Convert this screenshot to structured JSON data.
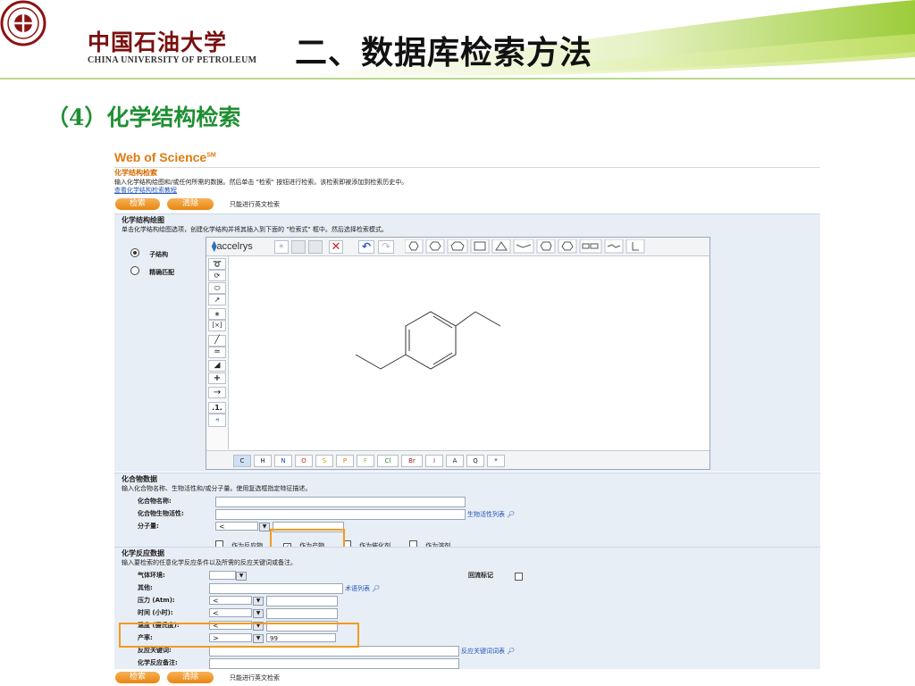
{
  "header": {
    "school_cn": "中国石油大学",
    "school_en": "CHINA UNIVERSITY OF PETROLEUM",
    "title": "二、数据库检索方法"
  },
  "subtitle": "（4）化学结构检索",
  "wos": {
    "logo": "Web of Science",
    "logo_sup": "SM",
    "section_title": "化学结构检索",
    "intro": "输入化学结构绘图和/或任何所需的数据。然后单击 \"检索\" 按钮进行检索。该检索即被添加到检索历史中。",
    "tutorial_link": "查看化学结构检索教程",
    "search_btn": "检索",
    "clear_btn": "清除",
    "english_only": "只能进行英文检索",
    "drawing": {
      "title": "化学结构绘图",
      "instruction": "单击化学结构绘图选项，创建化学结构并将其插入到下面的 \"检索式\" 框中。然后选择检索模式。",
      "mode_sub": "子结构",
      "mode_exact": "精确匹配",
      "editor_brand": "accelrys",
      "elements": [
        "C",
        "H",
        "N",
        "O",
        "S",
        "P",
        "F",
        "Cl",
        "Br",
        "I",
        "A",
        "Q",
        "*"
      ]
    },
    "compound": {
      "title": "化合物数据",
      "instruction": "输入化合物名称、生物活性和/或分子量。使用复选框指定特征描述。",
      "name_label": "化合物名称:",
      "bio_label": "化合物生物活性:",
      "bio_link": "生物活性列表",
      "mw_label": "分子量:",
      "mw_operator": "<",
      "role_reactant": "作为反应物",
      "role_product": "作为产物",
      "role_catalyst": "作为催化剂",
      "role_solvent": "作为溶剂"
    },
    "reaction": {
      "title": "化学反应数据",
      "instruction": "输入要检索的任意化学反应条件以及所需的反应关键词或备注。",
      "gas_label": "气体环境:",
      "reflux_label": "回流标记",
      "other_label": "其他:",
      "term_link": "术语列表",
      "pressure_label": "压力 (Atm):",
      "pressure_op": "<",
      "time_label": "时间 (小时):",
      "time_op": "<",
      "temp_label": "温度 (摄氏度):",
      "temp_op": "<",
      "yield_label": "产率:",
      "yield_op": ">",
      "yield_value": "99",
      "keyword_label": "反应关键词:",
      "keyword_link": "反应关键词词表",
      "note_label": "化学反应备注:"
    }
  },
  "colors": {
    "title_green": "#1f8f33",
    "wos_orange": "#e07a10",
    "highlight": "#f39a1e",
    "link_blue": "#2456b8"
  }
}
